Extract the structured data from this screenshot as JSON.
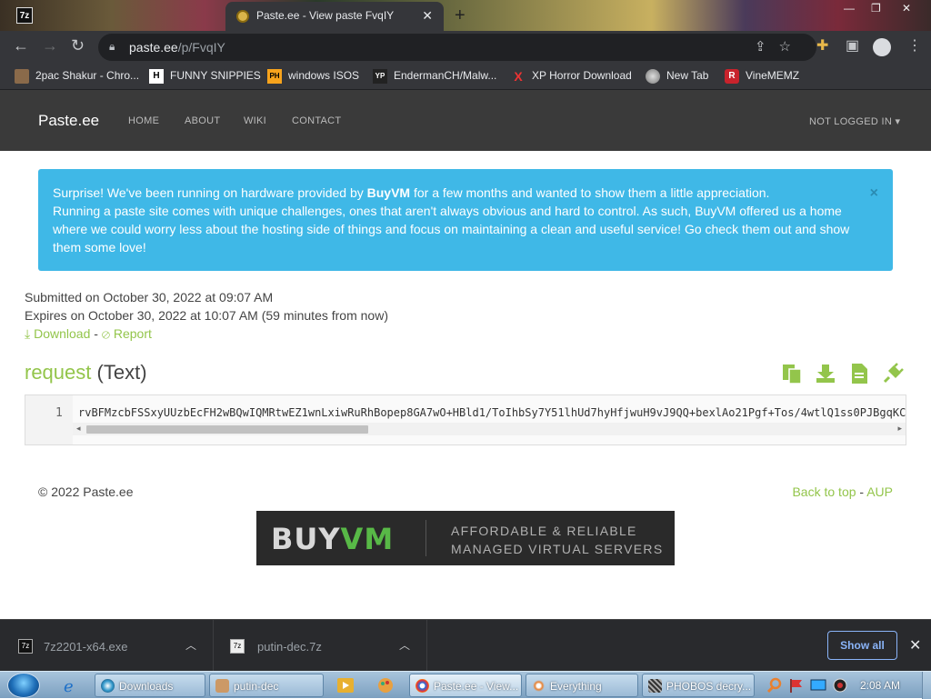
{
  "browser": {
    "active_tab_title": "Paste.ee - View paste FvqIY",
    "url_host": "paste.ee",
    "url_path": "/p/FvqIY",
    "bookmarks": [
      {
        "label": "2pac Shakur - Chro...",
        "icon": "2pac-icon"
      },
      {
        "label": "FUNNY SNIPPIES",
        "icon": "H"
      },
      {
        "label": "windows ISOS",
        "icon": "PH"
      },
      {
        "label": "EndermanCH/Malw...",
        "icon": "YP"
      },
      {
        "label": "XP Horror Download",
        "icon": "X"
      },
      {
        "label": "New Tab",
        "icon": "globe-icon"
      },
      {
        "label": "VineMEMZ",
        "icon": "R"
      }
    ]
  },
  "site": {
    "brand": "Paste.ee",
    "nav": [
      "HOME",
      "ABOUT",
      "WIKI",
      "CONTACT"
    ],
    "account": "NOT LOGGED IN"
  },
  "alert": {
    "line1_pre": "Surprise! We've been running on hardware provided by ",
    "line1_bold": "BuyVM",
    "line1_post": " for a few months and wanted to show them a little appreciation.",
    "line2": "Running a paste site comes with unique challenges, ones that aren't always obvious and hard to control. As such, BuyVM offered us a home where we could worry less about the hosting side of things and focus on maintaining a clean and useful service! Go check them out and show them some love!",
    "close": "×"
  },
  "paste": {
    "submitted": "Submitted on October 30, 2022 at 09:07 AM",
    "expires": "Expires on October 30, 2022 at 10:07 AM (59 minutes from now)",
    "download": "Download",
    "sep": "-",
    "report": "Report",
    "name": "request",
    "type": "(Text)",
    "line_number": "1",
    "code": "rvBFMzcbFSSxyUUzbEcFH2wBQwIQMRtwEZ1wnLxiwRuRhBopep8GA7wO+HBld1/ToIhbSy7Y51lhUd7hyHfjwuH9vJ9QQ+bexlAo21Pgf+Tos/4wtlQ1ss0PJBgqKCUF"
  },
  "footer": {
    "copyright": "© 2022 Paste.ee",
    "back_to_top": "Back to top",
    "sep": "-",
    "aup": "AUP"
  },
  "banner": {
    "logo_a": "BUY",
    "logo_b": "VM",
    "tag1": "AFFORDABLE & RELIABLE",
    "tag2": "MANAGED VIRTUAL SERVERS"
  },
  "downloads": {
    "items": [
      {
        "name": "7z2201-x64.exe"
      },
      {
        "name": "putin-dec.7z"
      }
    ],
    "show_all": "Show all"
  },
  "taskbar": {
    "items": [
      "Downloads",
      "putin-dec",
      "Paste.ee - View...",
      "Everything",
      "PHOBOS decry..."
    ],
    "clock": "2:08 AM"
  },
  "colors": {
    "accent_green": "#93c54b",
    "alert_blue": "#3fb8e7",
    "nav_bg": "#3a3a3a"
  }
}
